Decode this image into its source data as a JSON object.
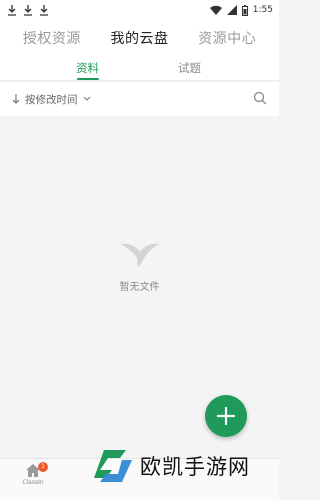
{
  "status_bar": {
    "time": "1:55"
  },
  "top_tabs": [
    {
      "label": "授权资源",
      "active": false
    },
    {
      "label": "我的云盘",
      "active": true
    },
    {
      "label": "资源中心",
      "active": false
    }
  ],
  "sub_tabs": [
    {
      "label": "资料",
      "active": true
    },
    {
      "label": "试题",
      "active": false
    }
  ],
  "sortbar": {
    "label": "按修改时间"
  },
  "empty_state": {
    "text": "暂无文件"
  },
  "bottom_nav": {
    "home_label": "ClassIn",
    "badge": "1"
  },
  "watermark": {
    "text": "欧凯手游网"
  },
  "colors": {
    "accent": "#1f9a5b",
    "badge": "#ef5a2b"
  }
}
